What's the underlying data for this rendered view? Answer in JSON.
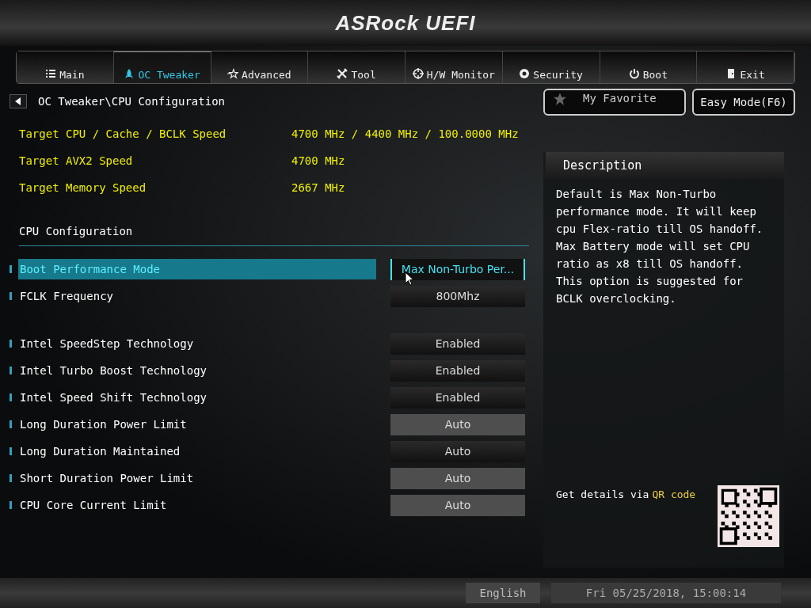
{
  "header": {
    "logo": "ASRock UEFI"
  },
  "tabs": [
    {
      "label": "Main",
      "selected": false
    },
    {
      "label": "OC Tweaker",
      "selected": true
    },
    {
      "label": "Advanced",
      "selected": false
    },
    {
      "label": "Tool",
      "selected": false
    },
    {
      "label": "H/W Monitor",
      "selected": false
    },
    {
      "label": "Security",
      "selected": false
    },
    {
      "label": "Boot",
      "selected": false
    },
    {
      "label": "Exit",
      "selected": false
    }
  ],
  "breadcrumb": "OC Tweaker\\CPU Configuration",
  "favorite_button": "My Favorite",
  "easy_mode_button": "Easy Mode(F6)",
  "targets": [
    {
      "label": "Target CPU / Cache / BCLK Speed",
      "value": "4700 MHz / 4400 MHz / 100.0000 MHz"
    },
    {
      "label": "Target AVX2 Speed",
      "value": "4700 MHz"
    },
    {
      "label": "Target Memory Speed",
      "value": "2667 MHz"
    }
  ],
  "section_title": "CPU Configuration",
  "setting_groups": [
    [
      {
        "label": "Boot Performance Mode",
        "value": "Max Non-Turbo Per...",
        "kind": "select",
        "selected": true
      },
      {
        "label": "FCLK Frequency",
        "value": "800Mhz",
        "kind": "select",
        "selected": false
      }
    ],
    [
      {
        "label": "Intel SpeedStep Technology",
        "value": "Enabled",
        "kind": "select",
        "selected": false
      },
      {
        "label": "Intel Turbo Boost Technology",
        "value": "Enabled",
        "kind": "select",
        "selected": false
      },
      {
        "label": "Intel Speed Shift Technology",
        "value": "Enabled",
        "kind": "select",
        "selected": false
      },
      {
        "label": "Long Duration Power Limit",
        "value": "Auto",
        "kind": "input",
        "selected": false
      },
      {
        "label": "Long Duration Maintained",
        "value": "Auto",
        "kind": "select",
        "selected": false
      },
      {
        "label": "Short Duration Power Limit",
        "value": "Auto",
        "kind": "input",
        "selected": false
      },
      {
        "label": "CPU Core Current Limit",
        "value": "Auto",
        "kind": "input",
        "selected": false
      }
    ]
  ],
  "description": {
    "title": "Description",
    "text": "Default is Max Non-Turbo performance mode. It will keep cpu Flex-ratio till OS handoff. Max Battery mode will set CPU ratio as x8 till OS handoff. This option is suggested for BCLK overclocking.",
    "qr_hint": "Get details via",
    "qr_hint_highlight": "QR code"
  },
  "status_bar": {
    "language": "English",
    "datetime": "Fri 05/25/2018, 15:00:14"
  }
}
